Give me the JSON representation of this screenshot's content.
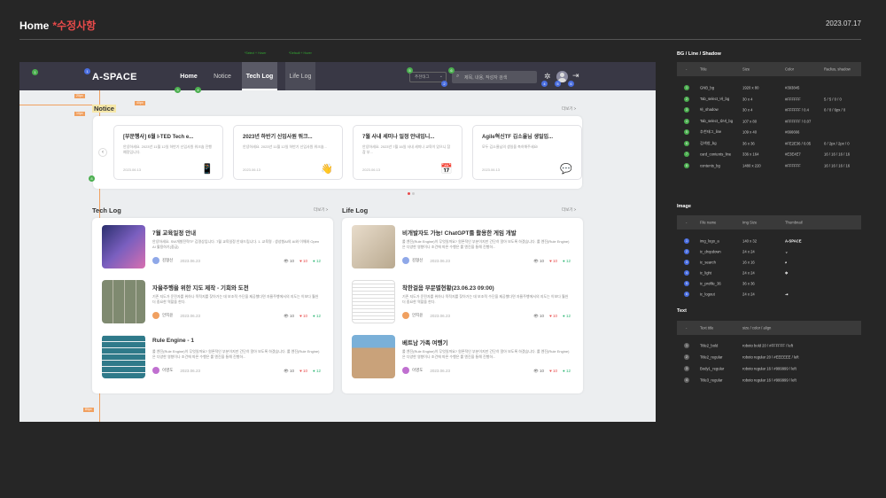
{
  "header": {
    "title": "Home",
    "subtitle": "*수정사항",
    "date": "2023.07.17"
  },
  "gnb": {
    "logo": "A-SPACE",
    "nav": [
      "Home",
      "Notice",
      "Tech Log",
      "Life Log"
    ],
    "dropdown": "추천태그",
    "search_placeholder": "제목, 내용, 작성자 검색",
    "hint_select": "*Select + Hover",
    "hint_default": "*Default + Hover"
  },
  "notice": {
    "title": "Notice",
    "more": "더보기 >",
    "cards": [
      {
        "title": "[부문행사] 6월 I-TED Tech e...",
        "desc": "안녕하세요. 2023년 11월 12일 하반기 신입사원 워크숍 진행예정입니다.",
        "date": "2023.06.13",
        "icon": "phone-icon",
        "glyph": "📱"
      },
      {
        "title": "2023년 하반기 신입사원 워크...",
        "desc": "안녕하세요. 2023년 11월 12일 하반기 신입사원 워크숍...",
        "date": "2023.06.13",
        "icon": "hand-icon",
        "glyph": "👋"
      },
      {
        "title": "7월 사내 세미나 일정 안내입니...",
        "desc": "안녕하세요. 2023년 7월 16일 사내 세미나 교육이 있으니 참참 부...",
        "date": "2023.06.13",
        "icon": "calendar-icon",
        "glyph": "📅"
      },
      {
        "title": "Agile혁신TF 김소율님 생일입...",
        "desc": "모두 김소율님의 생일을 축하해주세요!",
        "date": "2023.06.13",
        "icon": "chat-icon",
        "glyph": "💬"
      }
    ]
  },
  "tech": {
    "title": "Tech Log",
    "more": "더보기 >",
    "items": [
      {
        "title": "7월 교육일정 안내",
        "desc": "안녕하세요. SW개발전략TF 김명상입니다. 7월 교육일정 안내드립니다. 1. 교육명 : 생성형AI의 AI와 이해와 Open AI 활용하기(중급)",
        "author": "김형신",
        "date": "2023.06.23",
        "views": "10",
        "likes": "10",
        "comments": "12"
      },
      {
        "title": "자율주행을 위한 지도 제작 - 기회와 도전",
        "desc": "기존 지도가 운전자를 위하나 목적지를 찾아가는 데 보조적 수단을 제공했다면 자율주행에서의 지도는 이보다 훨씬 더 중요한 역할을 한다.",
        "author": "안지윤",
        "date": "2023.06.23",
        "views": "10",
        "likes": "10",
        "comments": "12"
      },
      {
        "title": "Rule Engine - 1",
        "desc": "룰 엔진(Rule Engine)이 무엇일까요? 원론적인 부분이지만 간단히 알아 보도록 하겠습니다. 룰 엔진(Rule Engine)은 다양한 영향이나 조건에 따른 수행은 룰 엔진을 통해 진행하...",
        "author": "이영도",
        "date": "2023.06.23",
        "views": "10",
        "likes": "10",
        "comments": "12"
      }
    ]
  },
  "life": {
    "title": "Life Log",
    "more": "더보기 >",
    "items": [
      {
        "title": "비개발자도 가능! ChatGPT를 활용한 게임 개발",
        "desc": "룰 엔진(Rule Engine)이 무엇일까요? 원론적인 부분이지만 간단히 알아 보도록 하겠습니다. 룰 엔진(Rule Engine)은 다양한 영향이나 조건에 따른 수행은 룰 엔진을 통해 진행하...",
        "author": "김형신",
        "date": "2023.06.23",
        "views": "10",
        "likes": "10",
        "comments": "12"
      },
      {
        "title": "착한걸음 부문별현황(23.06.23 09:00)",
        "desc": "기존 지도가 운전자를 위하나 목적지를 찾아가는 데 보조적 수단을 제공했다면 자율주행에서의 지도는 이보다 훨씬 더 중요한 역할을 한다.",
        "author": "안지윤",
        "date": "2023.06.23",
        "views": "10",
        "likes": "10",
        "comments": "12"
      },
      {
        "title": "베트남 가족 여행기",
        "desc": "룰 엔진(Rule Engine)이 무엇일까요? 원론적인 부분이지만 간단히 알아 보도록 하겠습니다. 룰 엔진(Rule Engine)은 다양한 영향이나 조건에 따른 수행은 룰 엔진을 통해 진행하...",
        "author": "이영도",
        "date": "2023.06.23",
        "views": "10",
        "likes": "10",
        "comments": "12"
      }
    ]
  },
  "spec": {
    "bg": {
      "title": "BG / Line / Shadow",
      "headers": [
        "-",
        "Title",
        "Size",
        "Color",
        "Radius, shadow"
      ],
      "rows": [
        [
          "1",
          "GNB_bg",
          "1920 x 80",
          "#393845",
          ""
        ],
        [
          "2",
          "Tab_select_바_bg",
          "30 x 4",
          "#FFFFFF",
          "5 / 5 / 0 / 0"
        ],
        [
          "3",
          "바_shadow",
          "30 x 4",
          "#FFFFFF / 0.4",
          "0 / 0 / 6px / 0"
        ],
        [
          "4",
          "Tab_select_호버_bg",
          "107 x 80",
          "#FFFFFF / 0.07",
          ""
        ],
        [
          "5",
          "추천태그_line",
          "109 x 40",
          "#666666",
          ""
        ],
        [
          "6",
          "검색창_bg",
          "36 x 36",
          "#FE2E36 / 0.05",
          "0 / 2px / 2px / 0"
        ],
        [
          "7",
          "card_contents_line",
          "336 x 164",
          "#E3E4E7",
          "16 / 16 / 16 / 16"
        ],
        [
          "8",
          "contents_bg",
          "1480 x 220",
          "#FFFFFF",
          "16 / 16 / 16 / 16"
        ]
      ]
    },
    "image": {
      "title": "Image",
      "headers": [
        "-",
        "File name",
        "Img Size",
        "Thumbnail"
      ],
      "rows": [
        [
          "1",
          "img_logo_a",
          "140 x 32",
          "A-SPACE"
        ],
        [
          "2",
          "ic_dropdown",
          "24 x 24",
          "⌄"
        ],
        [
          "3",
          "ic_search",
          "16 x 16",
          "⌕"
        ],
        [
          "4",
          "ic_light",
          "24 x 24",
          "✲"
        ],
        [
          "5",
          "ic_profile_36",
          "36 x 36",
          ""
        ],
        [
          "6",
          "ic_logout",
          "24 x 24",
          "⇥"
        ]
      ]
    },
    "text": {
      "title": "Text",
      "headers": [
        "-",
        "Text title",
        "size / color / align"
      ],
      "rows": [
        [
          "1",
          "Title2_bold",
          "roboto bold 20 / #FFFFFF / left"
        ],
        [
          "2",
          "Title2_regular",
          "roboto regular 20 / #EEEEEE / left"
        ],
        [
          "3",
          "Body1_regular",
          "roboto regular 16 / #999999 / left"
        ],
        [
          "4",
          "Title3_regular",
          "roboto regular 16 / #999999 / left"
        ]
      ]
    }
  },
  "colors": {
    "gnb": "#393845",
    "accent": "#e84a4a",
    "page_bg": "#262626"
  }
}
